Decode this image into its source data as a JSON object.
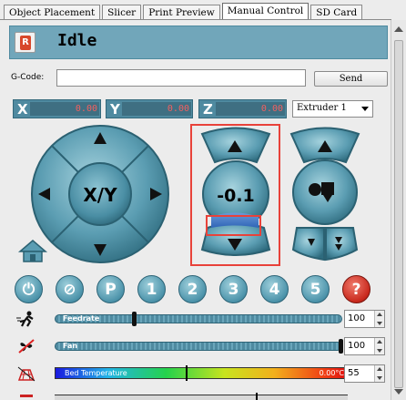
{
  "tabs": [
    {
      "label": "Object Placement",
      "active": false
    },
    {
      "label": "Slicer",
      "active": false
    },
    {
      "label": "Print Preview",
      "active": false
    },
    {
      "label": "Manual Control",
      "active": true
    },
    {
      "label": "SD Card",
      "active": false
    }
  ],
  "status": {
    "text": "Idle",
    "icon": "printer-logo-icon"
  },
  "gcode": {
    "label": "G-Code:",
    "value": "",
    "send_label": "Send"
  },
  "coords": [
    {
      "axis": "X",
      "value": "0.00"
    },
    {
      "axis": "Y",
      "value": "0.00"
    },
    {
      "axis": "Z",
      "value": "0.00"
    }
  ],
  "extruder": {
    "selected": "Extruder 1"
  },
  "jog": {
    "xy_label": "X/Y",
    "z_label": "-0.1",
    "home_icon": "home-icon",
    "extruder_icon": "extruder-icon"
  },
  "buttons": [
    {
      "name": "power-button",
      "glyph": "⏻"
    },
    {
      "name": "fan-off-button",
      "glyph": "⊘"
    },
    {
      "name": "park-button",
      "glyph": "P"
    },
    {
      "name": "preset-1-button",
      "glyph": "1"
    },
    {
      "name": "preset-2-button",
      "glyph": "2"
    },
    {
      "name": "preset-3-button",
      "glyph": "3"
    },
    {
      "name": "preset-4-button",
      "glyph": "4"
    },
    {
      "name": "preset-5-button",
      "glyph": "5"
    },
    {
      "name": "help-button",
      "glyph": "?"
    }
  ],
  "feedrate": {
    "label": "Feedrate",
    "value": "100",
    "level": 0.27
  },
  "fan": {
    "label": "Fan",
    "value": "100",
    "level": 1.0
  },
  "bed": {
    "label": "Bed Temperature",
    "current": "0.00°C",
    "target": "55",
    "target_level": 0.45
  },
  "colors": {
    "panel": "#71a6ba",
    "button": "#4c93aa",
    "highlight": "#e8423a",
    "coord_text": "#f06060"
  }
}
